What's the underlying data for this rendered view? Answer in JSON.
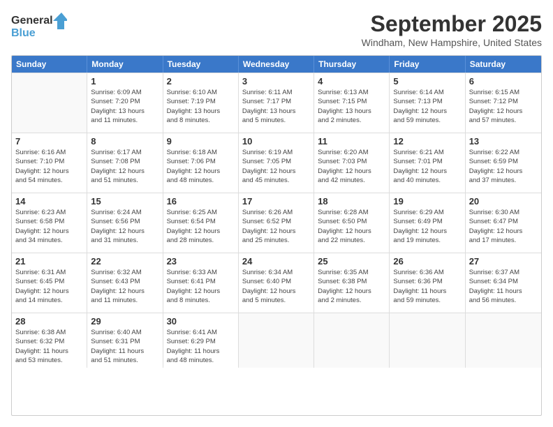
{
  "header": {
    "logo_text_general": "General",
    "logo_text_blue": "Blue",
    "month_title": "September 2025",
    "location": "Windham, New Hampshire, United States"
  },
  "calendar": {
    "days_of_week": [
      "Sunday",
      "Monday",
      "Tuesday",
      "Wednesday",
      "Thursday",
      "Friday",
      "Saturday"
    ],
    "rows": [
      [
        {
          "day": "",
          "info": ""
        },
        {
          "day": "1",
          "info": "Sunrise: 6:09 AM\nSunset: 7:20 PM\nDaylight: 13 hours\nand 11 minutes."
        },
        {
          "day": "2",
          "info": "Sunrise: 6:10 AM\nSunset: 7:19 PM\nDaylight: 13 hours\nand 8 minutes."
        },
        {
          "day": "3",
          "info": "Sunrise: 6:11 AM\nSunset: 7:17 PM\nDaylight: 13 hours\nand 5 minutes."
        },
        {
          "day": "4",
          "info": "Sunrise: 6:13 AM\nSunset: 7:15 PM\nDaylight: 13 hours\nand 2 minutes."
        },
        {
          "day": "5",
          "info": "Sunrise: 6:14 AM\nSunset: 7:13 PM\nDaylight: 12 hours\nand 59 minutes."
        },
        {
          "day": "6",
          "info": "Sunrise: 6:15 AM\nSunset: 7:12 PM\nDaylight: 12 hours\nand 57 minutes."
        }
      ],
      [
        {
          "day": "7",
          "info": "Sunrise: 6:16 AM\nSunset: 7:10 PM\nDaylight: 12 hours\nand 54 minutes."
        },
        {
          "day": "8",
          "info": "Sunrise: 6:17 AM\nSunset: 7:08 PM\nDaylight: 12 hours\nand 51 minutes."
        },
        {
          "day": "9",
          "info": "Sunrise: 6:18 AM\nSunset: 7:06 PM\nDaylight: 12 hours\nand 48 minutes."
        },
        {
          "day": "10",
          "info": "Sunrise: 6:19 AM\nSunset: 7:05 PM\nDaylight: 12 hours\nand 45 minutes."
        },
        {
          "day": "11",
          "info": "Sunrise: 6:20 AM\nSunset: 7:03 PM\nDaylight: 12 hours\nand 42 minutes."
        },
        {
          "day": "12",
          "info": "Sunrise: 6:21 AM\nSunset: 7:01 PM\nDaylight: 12 hours\nand 40 minutes."
        },
        {
          "day": "13",
          "info": "Sunrise: 6:22 AM\nSunset: 6:59 PM\nDaylight: 12 hours\nand 37 minutes."
        }
      ],
      [
        {
          "day": "14",
          "info": "Sunrise: 6:23 AM\nSunset: 6:58 PM\nDaylight: 12 hours\nand 34 minutes."
        },
        {
          "day": "15",
          "info": "Sunrise: 6:24 AM\nSunset: 6:56 PM\nDaylight: 12 hours\nand 31 minutes."
        },
        {
          "day": "16",
          "info": "Sunrise: 6:25 AM\nSunset: 6:54 PM\nDaylight: 12 hours\nand 28 minutes."
        },
        {
          "day": "17",
          "info": "Sunrise: 6:26 AM\nSunset: 6:52 PM\nDaylight: 12 hours\nand 25 minutes."
        },
        {
          "day": "18",
          "info": "Sunrise: 6:28 AM\nSunset: 6:50 PM\nDaylight: 12 hours\nand 22 minutes."
        },
        {
          "day": "19",
          "info": "Sunrise: 6:29 AM\nSunset: 6:49 PM\nDaylight: 12 hours\nand 19 minutes."
        },
        {
          "day": "20",
          "info": "Sunrise: 6:30 AM\nSunset: 6:47 PM\nDaylight: 12 hours\nand 17 minutes."
        }
      ],
      [
        {
          "day": "21",
          "info": "Sunrise: 6:31 AM\nSunset: 6:45 PM\nDaylight: 12 hours\nand 14 minutes."
        },
        {
          "day": "22",
          "info": "Sunrise: 6:32 AM\nSunset: 6:43 PM\nDaylight: 12 hours\nand 11 minutes."
        },
        {
          "day": "23",
          "info": "Sunrise: 6:33 AM\nSunset: 6:41 PM\nDaylight: 12 hours\nand 8 minutes."
        },
        {
          "day": "24",
          "info": "Sunrise: 6:34 AM\nSunset: 6:40 PM\nDaylight: 12 hours\nand 5 minutes."
        },
        {
          "day": "25",
          "info": "Sunrise: 6:35 AM\nSunset: 6:38 PM\nDaylight: 12 hours\nand 2 minutes."
        },
        {
          "day": "26",
          "info": "Sunrise: 6:36 AM\nSunset: 6:36 PM\nDaylight: 11 hours\nand 59 minutes."
        },
        {
          "day": "27",
          "info": "Sunrise: 6:37 AM\nSunset: 6:34 PM\nDaylight: 11 hours\nand 56 minutes."
        }
      ],
      [
        {
          "day": "28",
          "info": "Sunrise: 6:38 AM\nSunset: 6:32 PM\nDaylight: 11 hours\nand 53 minutes."
        },
        {
          "day": "29",
          "info": "Sunrise: 6:40 AM\nSunset: 6:31 PM\nDaylight: 11 hours\nand 51 minutes."
        },
        {
          "day": "30",
          "info": "Sunrise: 6:41 AM\nSunset: 6:29 PM\nDaylight: 11 hours\nand 48 minutes."
        },
        {
          "day": "",
          "info": ""
        },
        {
          "day": "",
          "info": ""
        },
        {
          "day": "",
          "info": ""
        },
        {
          "day": "",
          "info": ""
        }
      ]
    ]
  }
}
